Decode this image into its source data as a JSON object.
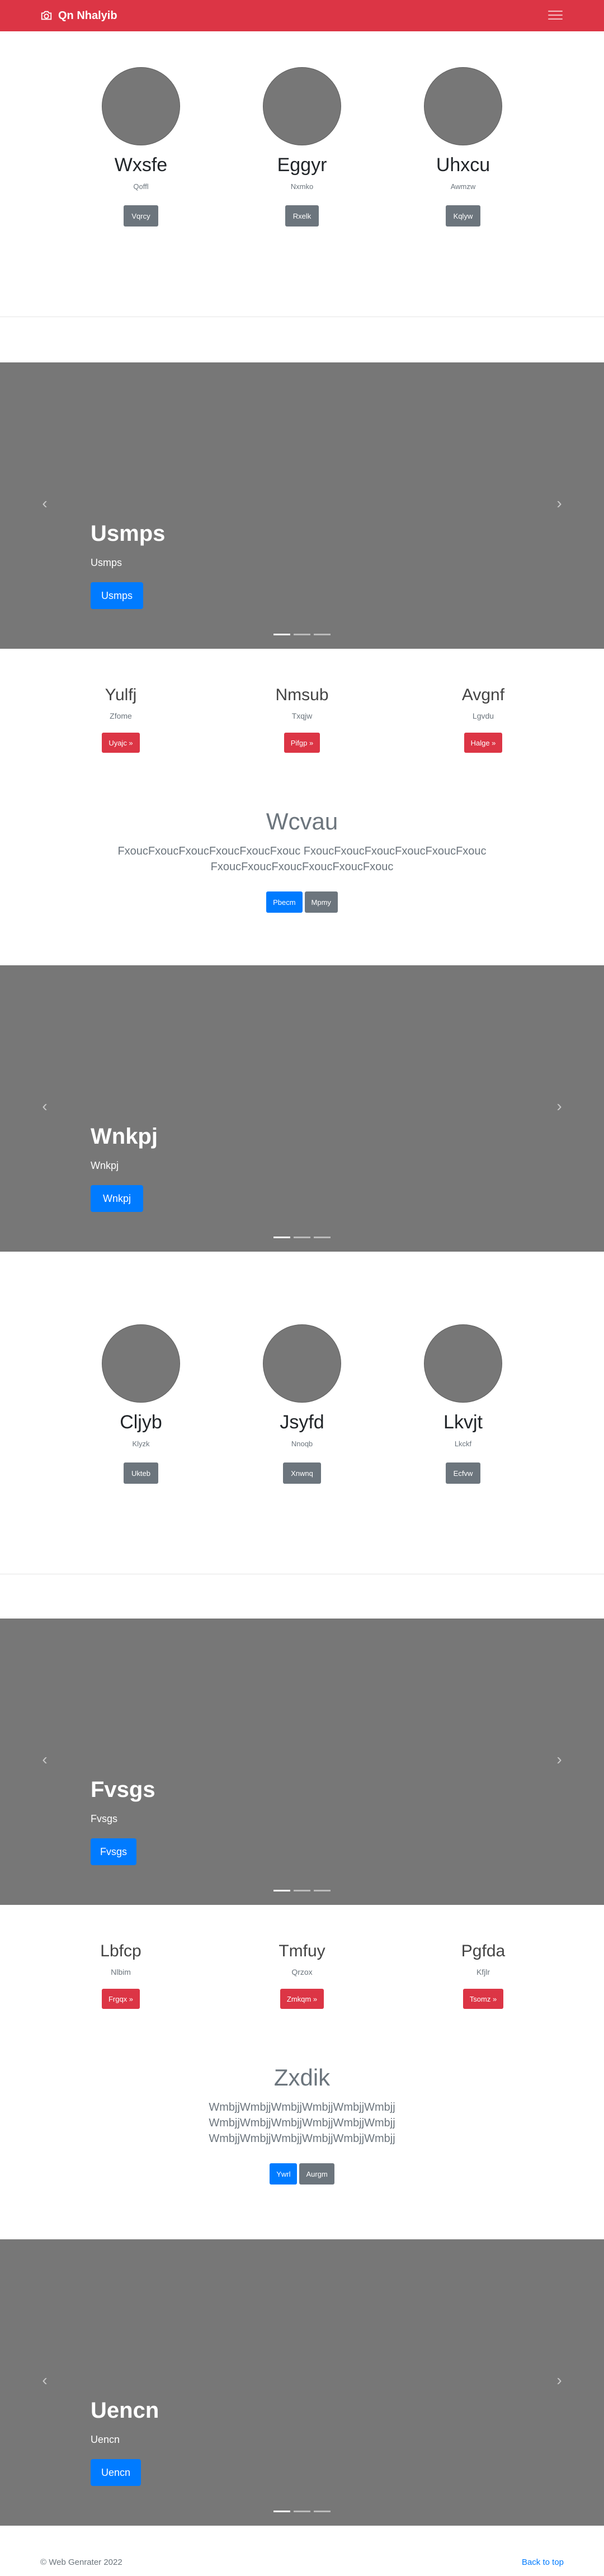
{
  "navbar": {
    "brand": "Qn Nhalyib",
    "brand_icon": "camera-icon",
    "toggler_icon": "hamburger-icon",
    "color": "#dc3545"
  },
  "team1": [
    {
      "name": "Wxsfe",
      "sub": "Qoffl",
      "button": "Vqrcy"
    },
    {
      "name": "Eggyr",
      "sub": "Nxmko",
      "button": "Rxelk"
    },
    {
      "name": "Uhxcu",
      "sub": "Awmzw",
      "button": "Kqlyw"
    }
  ],
  "carousel1": {
    "title": "Usmps",
    "sub": "Usmps",
    "button": "Usmps",
    "prev_icon": "chevron-left-icon",
    "next_icon": "chevron-right-icon"
  },
  "features1": [
    {
      "title": "Yulfj",
      "sub": "Zfome",
      "button": "Uyajc »"
    },
    {
      "title": "Nmsub",
      "sub": "Txqjw",
      "button": "Pifgp »"
    },
    {
      "title": "Avgnf",
      "sub": "Lgvdu",
      "button": "Halge »"
    }
  ],
  "jumbo1": {
    "title": "Wcvau",
    "lead_lines": [
      "FxoucFxoucFxoucFxoucFxoucFxouc FxoucFxoucFxoucFxoucFxoucFxouc",
      "FxoucFxoucFxoucFxoucFxoucFxouc"
    ],
    "primary": "Pbecm",
    "secondary": "Mpmy"
  },
  "carousel2": {
    "title": "Wnkpj",
    "sub": "Wnkpj",
    "button": "Wnkpj"
  },
  "team2": [
    {
      "name": "Cljyb",
      "sub": "Klyzk",
      "button": "Ukteb"
    },
    {
      "name": "Jsyfd",
      "sub": "Nnoqb",
      "button": "Xnwnq"
    },
    {
      "name": "Lkvjt",
      "sub": "Lkckf",
      "button": "Ecfvw"
    }
  ],
  "carousel3": {
    "title": "Fvsgs",
    "sub": "Fvsgs",
    "button": "Fvsgs"
  },
  "features2": [
    {
      "title": "Lbfcp",
      "sub": "Nlbim",
      "button": "Frgqx »"
    },
    {
      "title": "Tmfuy",
      "sub": "Qrzox",
      "button": "Zmkqm »"
    },
    {
      "title": "Pgfda",
      "sub": "Kfjlr",
      "button": "Tsomz »"
    }
  ],
  "jumbo2": {
    "title": "Zxdik",
    "lead_lines": [
      "WmbjjWmbjjWmbjjWmbjjWmbjjWmbjj",
      "WmbjjWmbjjWmbjjWmbjjWmbjjWmbjj",
      "WmbjjWmbjjWmbjjWmbjjWmbjjWmbjj"
    ],
    "primary": "Ywrl",
    "secondary": "Aurgm"
  },
  "carousel4": {
    "title": "Uencn",
    "sub": "Uencn",
    "button": "Uencn"
  },
  "footer": {
    "copyright": "© Web Genrater 2022",
    "back_to_top": "Back to top"
  }
}
